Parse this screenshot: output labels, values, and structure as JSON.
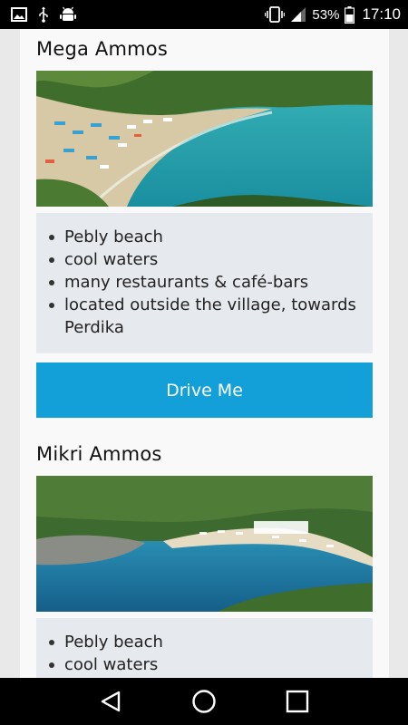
{
  "status_bar": {
    "battery_percent": "53%",
    "time": "17:10",
    "left_icons": [
      "image-icon",
      "usb-icon",
      "android-debug-icon"
    ],
    "right_icons": [
      "vibrate-icon",
      "signal-icon",
      "battery-icon"
    ]
  },
  "beaches": [
    {
      "name": "Mega Ammos",
      "features": [
        "Pebly beach",
        "cool waters",
        "many restaurants & café-bars",
        "located outside the village, towards Perdika"
      ],
      "button_label": "Drive Me"
    },
    {
      "name": "Mikri Ammos",
      "features": [
        "Pebly beach",
        "cool waters"
      ]
    }
  ],
  "nav_bar": {
    "buttons": [
      "back-icon",
      "home-icon",
      "recents-icon"
    ]
  },
  "colors": {
    "accent": "#139fd8",
    "info_box": "#e6e9ee",
    "status_bar": "#000000"
  }
}
